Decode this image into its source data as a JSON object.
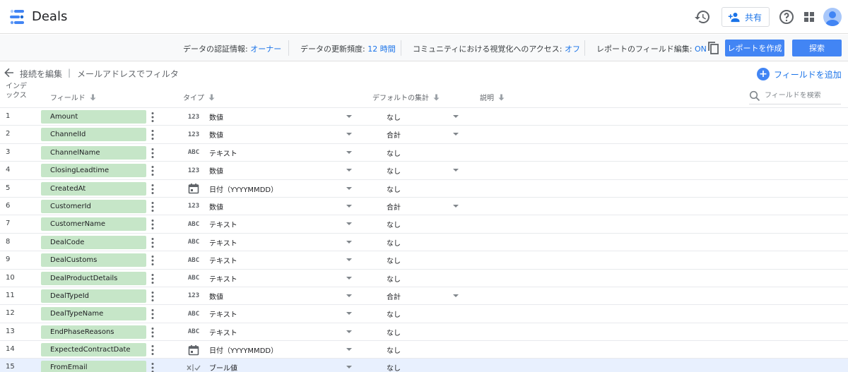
{
  "header": {
    "title": "Deals",
    "share_label": "共有"
  },
  "subbar": {
    "credentials_label": "データの認証情報: ",
    "credentials_value": "オーナー",
    "freshness_label": "データの更新頻度: ",
    "freshness_value": "12 時間",
    "community_label": "コミュニティにおける視覚化へのアクセス: ",
    "community_value": "オフ",
    "field_edit_label": "レポートのフィールド編集: ",
    "field_edit_value": "ON",
    "create_report_label": "レポートを作成",
    "explore_label": "探索"
  },
  "actions": {
    "edit_connection": "接続を編集",
    "separator": "|",
    "filter_by_email": "メールアドレスでフィルタ",
    "add_field": "フィールドを追加"
  },
  "columns": {
    "index": "インデックス",
    "field": "フィールド",
    "type": "タイプ",
    "aggregation": "デフォルトの集計",
    "description": "説明",
    "search_placeholder": "フィールドを検索"
  },
  "rows": [
    {
      "index": "1",
      "field": "Amount",
      "type_icon": "123",
      "type": "数値",
      "agg": "なし",
      "agg_dropdown": true
    },
    {
      "index": "2",
      "field": "ChannelId",
      "type_icon": "123",
      "type": "数値",
      "agg": "合計",
      "agg_dropdown": true
    },
    {
      "index": "3",
      "field": "ChannelName",
      "type_icon": "ABC",
      "type": "テキスト",
      "agg": "なし",
      "agg_dropdown": false
    },
    {
      "index": "4",
      "field": "ClosingLeadtime",
      "type_icon": "123",
      "type": "数値",
      "agg": "なし",
      "agg_dropdown": true
    },
    {
      "index": "5",
      "field": "CreatedAt",
      "type_icon": "calendar-icon",
      "type": "日付（YYYYMMDD）",
      "agg": "なし",
      "agg_dropdown": false
    },
    {
      "index": "6",
      "field": "CustomerId",
      "type_icon": "123",
      "type": "数値",
      "agg": "合計",
      "agg_dropdown": true
    },
    {
      "index": "7",
      "field": "CustomerName",
      "type_icon": "ABC",
      "type": "テキスト",
      "agg": "なし",
      "agg_dropdown": false
    },
    {
      "index": "8",
      "field": "DealCode",
      "type_icon": "ABC",
      "type": "テキスト",
      "agg": "なし",
      "agg_dropdown": false
    },
    {
      "index": "9",
      "field": "DealCustoms",
      "type_icon": "ABC",
      "type": "テキスト",
      "agg": "なし",
      "agg_dropdown": false
    },
    {
      "index": "10",
      "field": "DealProductDetails",
      "type_icon": "ABC",
      "type": "テキスト",
      "agg": "なし",
      "agg_dropdown": false
    },
    {
      "index": "11",
      "field": "DealTypeId",
      "type_icon": "123",
      "type": "数値",
      "agg": "合計",
      "agg_dropdown": true
    },
    {
      "index": "12",
      "field": "DealTypeName",
      "type_icon": "ABC",
      "type": "テキスト",
      "agg": "なし",
      "agg_dropdown": false
    },
    {
      "index": "13",
      "field": "EndPhaseReasons",
      "type_icon": "ABC",
      "type": "テキスト",
      "agg": "なし",
      "agg_dropdown": false
    },
    {
      "index": "14",
      "field": "ExpectedContractDate",
      "type_icon": "calendar-icon",
      "type": "日付（YYYYMMDD）",
      "agg": "なし",
      "agg_dropdown": false
    },
    {
      "index": "15",
      "field": "FromEmail",
      "type_icon": "boolean-icon",
      "type": "ブール値",
      "agg": "なし",
      "agg_dropdown": false
    }
  ],
  "colors": {
    "accent": "#1a73e8",
    "button": "#4285f4",
    "chip": "#c6e6c8",
    "row_highlight": "#e8f0fe"
  }
}
